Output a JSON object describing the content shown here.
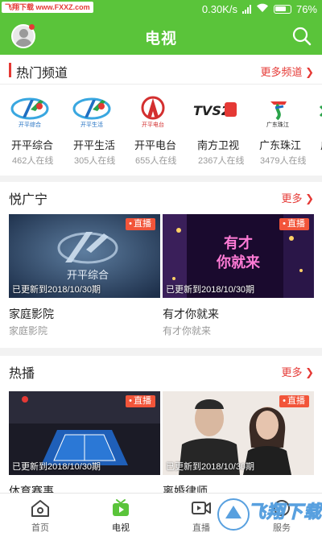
{
  "status_bar": {
    "site_badge": "飞翔下载 www.FXXZ.com",
    "speed": "0.30K/s",
    "battery": "76%"
  },
  "header": {
    "title": "电视"
  },
  "hot_channels": {
    "title": "热门频道",
    "more_label": "更多频道 ❯",
    "channels": [
      {
        "name": "开平综合",
        "viewers": "462人在线",
        "logo_text": "开平综合"
      },
      {
        "name": "开平生活",
        "viewers": "305人在线",
        "logo_text": "开平生活"
      },
      {
        "name": "开平电台",
        "viewers": "655人在线",
        "logo_text": "开平电台"
      },
      {
        "name": "南方卫视",
        "viewers": "2367人在线",
        "logo_text": "TVS2"
      },
      {
        "name": "广东珠江",
        "viewers": "3479人在线",
        "logo_text": "广东珠江"
      },
      {
        "name": "广",
        "viewers": "",
        "logo_text": ""
      }
    ]
  },
  "yue_guangning": {
    "title": "悦广宁",
    "more_label": "更多 ❯",
    "cards": [
      {
        "badge": "直播",
        "update": "已更新到2018/10/30期",
        "title": "家庭影院",
        "sub": "家庭影院",
        "thumb_text": "开平综合"
      },
      {
        "badge": "直播",
        "update": "已更新到2018/10/30期",
        "title": "有才你就来",
        "sub": "有才你就来",
        "thumb_text_1": "有才",
        "thumb_text_2": "你就来"
      }
    ]
  },
  "rebo": {
    "title": "热播",
    "more_label": "更多 ❯",
    "cards": [
      {
        "badge": "直播",
        "update": "已更新到2018/10/30期",
        "title": "体育赛事"
      },
      {
        "badge": "直播",
        "update": "已更新到2018/10/30期",
        "title": "离婚律师"
      }
    ]
  },
  "bottom_nav": [
    {
      "label": "首页"
    },
    {
      "label": "电视"
    },
    {
      "label": "直播"
    },
    {
      "label": "服务"
    }
  ],
  "watermark": {
    "text": "飞翔下载"
  },
  "colors": {
    "brand_green": "#5ac43a",
    "accent_red": "#e53935",
    "live_orange": "#f2553a"
  }
}
